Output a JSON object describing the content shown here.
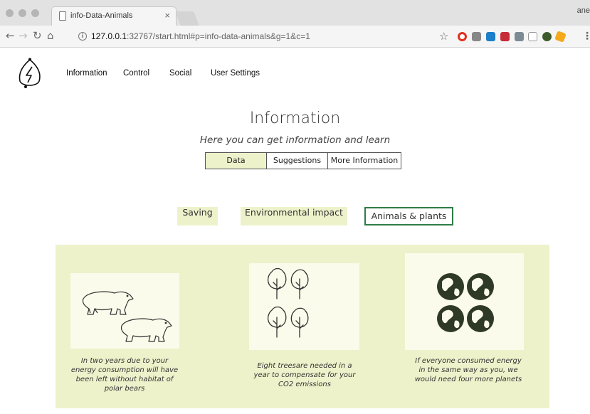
{
  "browser": {
    "tab_title": "info-Data-Animals",
    "tab_close": "×",
    "profile": "ane",
    "url_host": "127.0.0.1",
    "url_rest": ":32767/start.html#p=info-data-animals&g=1&c=1",
    "icons": [
      "back-icon",
      "forward-icon",
      "reload-icon",
      "home-icon",
      "info-icon",
      "star-icon",
      "menu-icon"
    ]
  },
  "nav": {
    "items": [
      "Information",
      "Control",
      "Social",
      "User Settings"
    ]
  },
  "header": {
    "title": "Information",
    "subtitle": "Here you can get information and learn"
  },
  "subtabs": {
    "items": [
      "Data",
      "Suggestions",
      "More Information"
    ],
    "active": "Data"
  },
  "categories": {
    "items": [
      "Saving",
      "Environmental impact",
      "Animals & plants"
    ],
    "selected": "Animals & plants"
  },
  "cards": [
    {
      "icon": "polar-bears-icon",
      "text": "In two years due to your energy consumption will have been left without habitat of polar bears"
    },
    {
      "icon": "trees-icon",
      "text": "Eight treesare needed in a year to compensate for your CO2 emissions"
    },
    {
      "icon": "planets-icon",
      "text": "If everyone consumed energy in the same way as you, we would need four more planets"
    }
  ],
  "colors": {
    "accent_bg": "#eef2cb",
    "selected_border": "#2e7d46",
    "planet": "#2f3a26"
  }
}
